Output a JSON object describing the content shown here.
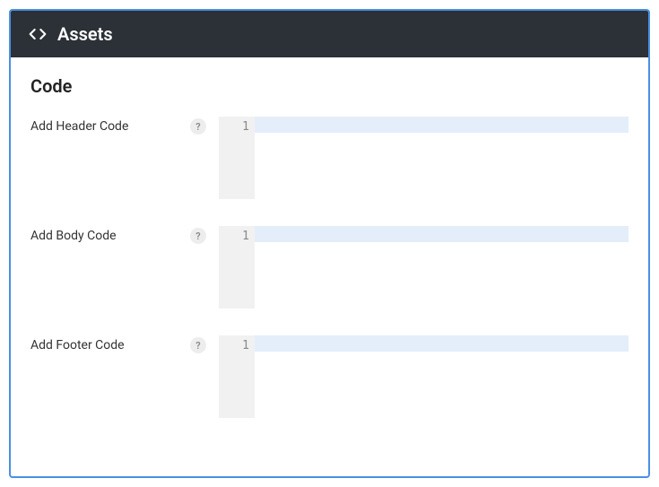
{
  "panel": {
    "title": "Assets"
  },
  "section": {
    "title": "Code"
  },
  "fields": {
    "header": {
      "label": "Add Header Code",
      "help": "?",
      "line_number": "1",
      "value": ""
    },
    "body": {
      "label": "Add Body Code",
      "help": "?",
      "line_number": "1",
      "value": ""
    },
    "footer": {
      "label": "Add Footer Code",
      "help": "?",
      "line_number": "1",
      "value": ""
    }
  }
}
